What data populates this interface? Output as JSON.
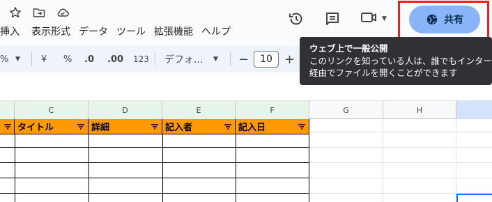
{
  "title_bar": {
    "icons": [
      "star-icon",
      "move-to-folder-icon",
      "cloud-status-icon"
    ]
  },
  "menu": {
    "items": [
      "挿入",
      "表示形式",
      "データ",
      "ツール",
      "拡張機能",
      "ヘルプ"
    ]
  },
  "header_actions": {
    "icons": [
      "history-icon",
      "comment-icon",
      "video-camera-icon"
    ],
    "share_label": "共有",
    "share_icon": "globe-icon"
  },
  "tooltip": {
    "title": "ウェブ上で一般公開",
    "line1": "このリンクを知っている人は、誰でもインター",
    "line2": "経由でファイルを開くことができます"
  },
  "toolbar": {
    "percent_left": "%",
    "currency": "¥",
    "percent": "%",
    "decrease_decimal": ".0",
    "increase_decimal": ".00",
    "number_format": "123",
    "font_name": "デフォ...",
    "minus": "−",
    "font_size": "10",
    "plus": "+"
  },
  "columns": {
    "C": "C",
    "D": "D",
    "E": "E",
    "F": "F",
    "G": "G",
    "H": "H"
  },
  "table_headers": [
    "タイトル",
    "詳細",
    "記入者",
    "記入日"
  ],
  "colors": {
    "header_fill": "#ff9900",
    "share_button": "#8ab4f8",
    "highlight_box": "#ff1a1a",
    "tooltip_bg": "#303134",
    "selected_column": "#d3e3fd"
  }
}
